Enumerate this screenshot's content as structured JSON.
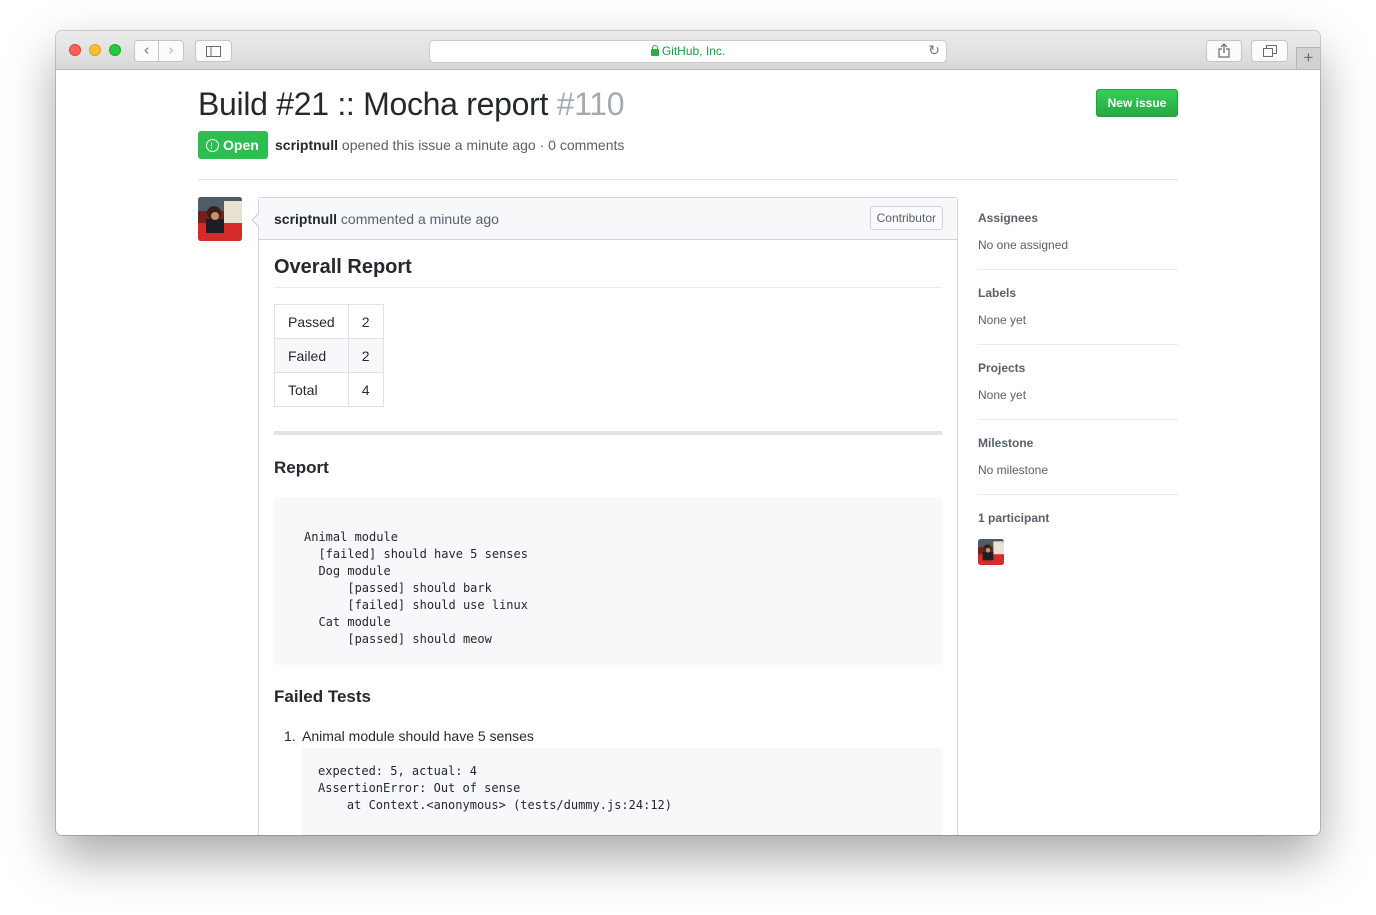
{
  "browser": {
    "address": "GitHub, Inc."
  },
  "issue": {
    "title": "Build #21 :: Mocha report",
    "number": "#110",
    "state": "Open",
    "author": "scriptnull",
    "meta_text": "opened this issue a minute ago · 0 comments",
    "new_issue_label": "New issue"
  },
  "comment": {
    "author": "scriptnull",
    "meta_text": "commented a minute ago",
    "role": "Contributor",
    "overall_heading": "Overall Report",
    "summary": [
      {
        "label": "Passed",
        "value": "2"
      },
      {
        "label": "Failed",
        "value": "2"
      },
      {
        "label": "Total",
        "value": "4"
      }
    ],
    "report_heading": "Report",
    "report_lines": [
      "Animal module",
      "  [failed] should have 5 senses",
      "  Dog module",
      "      [passed] should bark",
      "      [failed] should use linux",
      "  Cat module",
      "      [passed] should meow"
    ],
    "failed_heading": "Failed Tests",
    "failed_tests": [
      {
        "num": "1.",
        "title": "Animal module should have 5 senses",
        "lines": [
          "expected: 5, actual: 4",
          "AssertionError: Out of sense",
          "    at Context.<anonymous> (tests/dummy.js:24:12)"
        ]
      }
    ]
  },
  "sidebar": {
    "assignees": {
      "heading": "Assignees",
      "value": "No one assigned"
    },
    "labels": {
      "heading": "Labels",
      "value": "None yet"
    },
    "projects": {
      "heading": "Projects",
      "value": "None yet"
    },
    "milestone": {
      "heading": "Milestone",
      "value": "No milestone"
    },
    "participants": {
      "heading": "1 participant"
    }
  },
  "colors": {
    "open_badge": "#2cbe4e",
    "new_issue_button": "#28a745",
    "issue_number": "#a3aab1"
  }
}
